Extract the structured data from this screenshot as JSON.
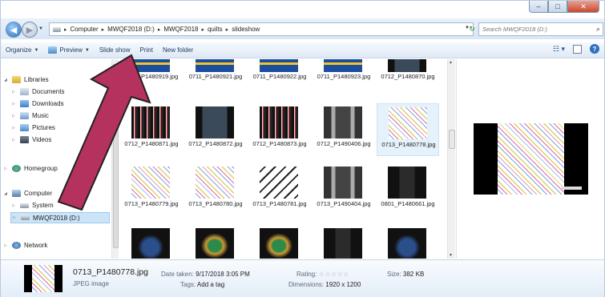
{
  "window": {
    "caption_buttons": {
      "minimize": "–",
      "maximize": "□",
      "close": "✕"
    }
  },
  "address_bar": {
    "crumbs": [
      "Computer",
      "MWQF2018 (D:)",
      "MWQF2018",
      "quilts",
      "slideshow"
    ],
    "search_placeholder": "Search MWQF2018 (D:)"
  },
  "toolbar": {
    "organize": "Organize",
    "preview": "Preview",
    "slideshow": "Slide show",
    "print": "Print",
    "new_folder": "New folder"
  },
  "nav": {
    "libraries": "Libraries",
    "documents": "Documents",
    "downloads": "Downloads",
    "music": "Music",
    "pictures": "Pictures",
    "videos": "Videos",
    "homegroup": "Homegroup",
    "computer": "Computer",
    "system": "System",
    "drive": "MWQF2018 (D:)",
    "network": "Network"
  },
  "files": {
    "row1": [
      {
        "label": "0711_P1480919.jpg"
      },
      {
        "label": "0711_P1480921.jpg"
      },
      {
        "label": "0711_P1480922.jpg"
      },
      {
        "label": "0711_P1480923.jpg"
      },
      {
        "label": "0712_P1480870.jpg"
      }
    ],
    "row2": [
      {
        "label": "0712_P1480871.jpg"
      },
      {
        "label": "0712_P1480872.jpg"
      },
      {
        "label": "0712_P1480873.jpg"
      },
      {
        "label": "0712_P1490406.jpg"
      },
      {
        "label": "0713_P1480778.jpg"
      }
    ],
    "row3": [
      {
        "label": "0713_P1480779.jpg"
      },
      {
        "label": "0713_P1480780.jpg"
      },
      {
        "label": "0713_P1480781.jpg"
      },
      {
        "label": "0713_P1490404.jpg"
      },
      {
        "label": "0801_P1480661.jpg"
      }
    ]
  },
  "details": {
    "name": "0713_P1480778.jpg",
    "type": "JPEG image",
    "date_key": "Date taken:",
    "date_val": "9/17/2018 3:05 PM",
    "tags_key": "Tags:",
    "tags_val": "Add a tag",
    "rating_key": "Rating:",
    "rating_stars": "☆☆☆☆☆",
    "dims_key": "Dimensions:",
    "dims_val": "1920 x 1200",
    "size_key": "Size:",
    "size_val": "382 KB"
  },
  "colors": {
    "arrow_fill": "#b5315e",
    "arrow_stroke": "#222222",
    "selection": "#cce4f7",
    "toolbar_text": "#1e395b"
  }
}
